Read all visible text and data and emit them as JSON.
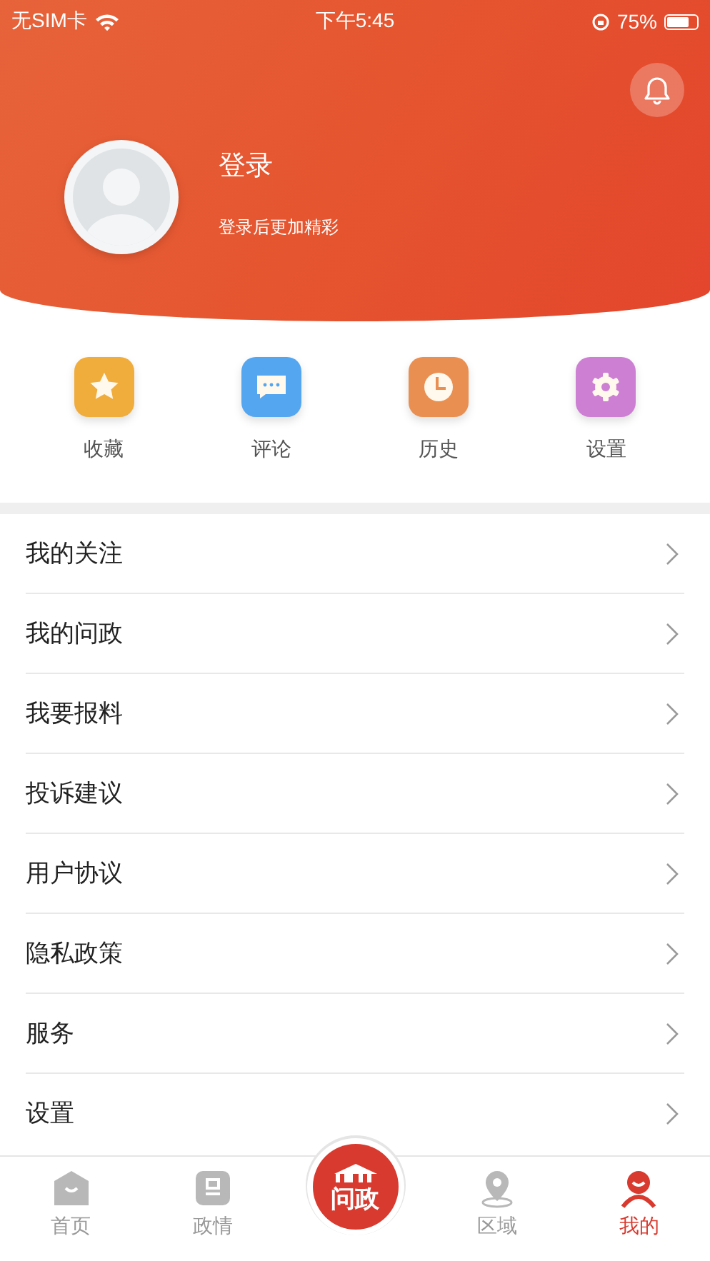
{
  "status_bar": {
    "carrier": "无SIM卡",
    "time": "下午5:45",
    "battery": "75%"
  },
  "profile": {
    "title": "登录",
    "subtitle": "登录后更加精彩"
  },
  "shortcuts": [
    {
      "label": "收藏",
      "kind": "star",
      "color": "#f0ad3c"
    },
    {
      "label": "评论",
      "kind": "comment",
      "color": "#55a6f0"
    },
    {
      "label": "历史",
      "kind": "clock",
      "color": "#ea8f52"
    },
    {
      "label": "设置",
      "kind": "gear",
      "color": "#cd7fd4"
    }
  ],
  "menu": [
    "我的关注",
    "我的问政",
    "我要报料",
    "投诉建议",
    "用户协议",
    "隐私政策",
    "服务",
    "设置"
  ],
  "tab_bar": [
    {
      "label": "首页",
      "kind": "home",
      "selected": false
    },
    {
      "label": "政情",
      "kind": "news",
      "selected": false
    },
    {
      "label": "问政",
      "kind": "logo",
      "selected": false
    },
    {
      "label": "区域",
      "kind": "pin",
      "selected": false
    },
    {
      "label": "我的",
      "kind": "me",
      "selected": true
    }
  ]
}
